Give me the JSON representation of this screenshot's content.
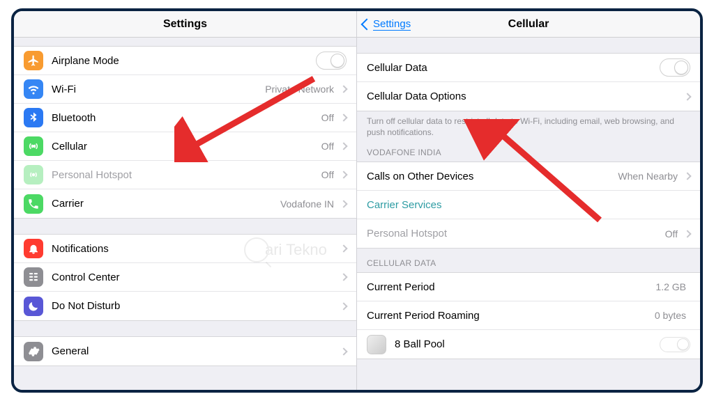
{
  "left": {
    "title": "Settings",
    "group1": [
      {
        "label": "Airplane Mode",
        "toggle": "off",
        "icon": "airplane",
        "iconBg": "#f89b30"
      },
      {
        "label": "Wi-Fi",
        "detail": "Private Network",
        "chevron": true,
        "icon": "wifi",
        "iconBg": "#3586f4"
      },
      {
        "label": "Bluetooth",
        "detail": "Off",
        "chevron": true,
        "icon": "bluetooth",
        "iconBg": "#2b79f3"
      },
      {
        "label": "Cellular",
        "detail": "Off",
        "chevron": true,
        "icon": "cellular",
        "iconBg": "#4cd964"
      },
      {
        "label": "Personal Hotspot",
        "detail": "Off",
        "chevron": true,
        "icon": "hotspot",
        "iconBg": "#4cd964",
        "muted": true
      },
      {
        "label": "Carrier",
        "detail": "Vodafone IN",
        "chevron": true,
        "icon": "phone",
        "iconBg": "#4cd964"
      }
    ],
    "group2": [
      {
        "label": "Notifications",
        "chevron": true,
        "icon": "bell",
        "iconBg": "#ff3b30"
      },
      {
        "label": "Control Center",
        "chevron": true,
        "icon": "control",
        "iconBg": "#8e8e93"
      },
      {
        "label": "Do Not Disturb",
        "chevron": true,
        "icon": "moon",
        "iconBg": "#5957d6"
      }
    ],
    "group3": [
      {
        "label": "General",
        "chevron": true,
        "icon": "gear",
        "iconBg": "#8e8e93"
      }
    ]
  },
  "right": {
    "backLabel": "Settings",
    "title": "Cellular",
    "group1": [
      {
        "label": "Cellular Data",
        "toggle": "off"
      },
      {
        "label": "Cellular Data Options",
        "chevron": true
      }
    ],
    "footerText": "Turn off cellular data to restrict all data to Wi-Fi, including email, web browsing, and push notifications.",
    "group2Header": "VODAFONE INDIA",
    "group2": [
      {
        "label": "Calls on Other Devices",
        "detail": "When Nearby",
        "chevron": true
      },
      {
        "label": "Carrier Services",
        "link": true
      },
      {
        "label": "Personal Hotspot",
        "detail": "Off",
        "chevron": true,
        "muted": true
      }
    ],
    "group3Header": "CELLULAR DATA",
    "group3": [
      {
        "label": "Current Period",
        "detail": "1.2 GB"
      },
      {
        "label": "Current Period Roaming",
        "detail": "0 bytes"
      },
      {
        "label": "8 Ball Pool",
        "appIcon": true,
        "toggle": "off-small"
      }
    ]
  },
  "watermark": "ari Tekno"
}
